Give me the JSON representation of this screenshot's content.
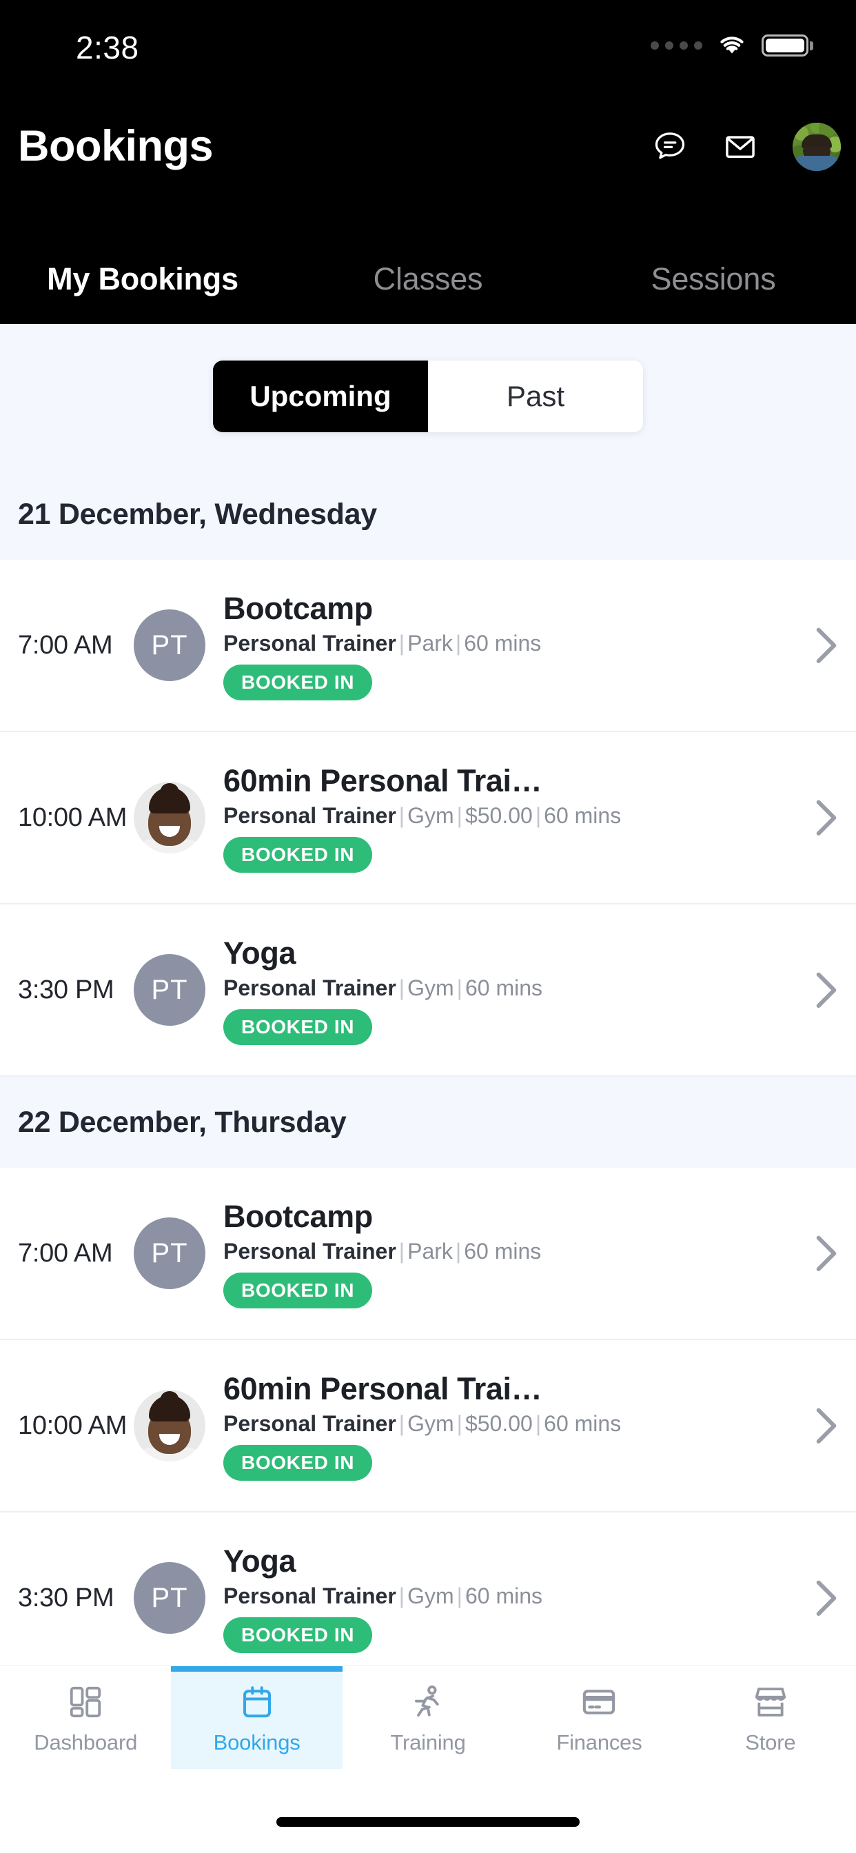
{
  "statusbar": {
    "time": "2:38",
    "signal_dots": 4,
    "wifi": "wifi-icon",
    "battery_full": true
  },
  "header": {
    "title": "Bookings",
    "icons": [
      {
        "name": "chat-icon",
        "label": "Messages"
      },
      {
        "name": "mail-icon",
        "label": "Mail"
      }
    ],
    "avatar_alt": "Profile"
  },
  "top_tabs": [
    {
      "label": "My Bookings",
      "active": true
    },
    {
      "label": "Classes",
      "active": false
    },
    {
      "label": "Sessions",
      "active": false
    }
  ],
  "segment": [
    {
      "label": "Upcoming",
      "active": true
    },
    {
      "label": "Past",
      "active": false
    }
  ],
  "days": [
    {
      "date_label": "21 December, Wednesday",
      "bookings": [
        {
          "time": "7:00 AM",
          "avatar_type": "initials",
          "avatar_initials": "PT",
          "title": "Bootcamp",
          "role": "Personal Trainer",
          "location": "Park",
          "price": "",
          "duration": "60 mins",
          "status": "BOOKED IN"
        },
        {
          "time": "10:00 AM",
          "avatar_type": "photo",
          "avatar_initials": "",
          "title": "60min Personal Trai…",
          "role": "Personal Trainer",
          "location": "Gym",
          "price": "$50.00",
          "duration": "60 mins",
          "status": "BOOKED IN"
        },
        {
          "time": "3:30 PM",
          "avatar_type": "initials",
          "avatar_initials": "PT",
          "title": "Yoga",
          "role": "Personal Trainer",
          "location": "Gym",
          "price": "",
          "duration": "60 mins",
          "status": "BOOKED IN"
        }
      ]
    },
    {
      "date_label": "22 December, Thursday",
      "bookings": [
        {
          "time": "7:00 AM",
          "avatar_type": "initials",
          "avatar_initials": "PT",
          "title": "Bootcamp",
          "role": "Personal Trainer",
          "location": "Park",
          "price": "",
          "duration": "60 mins",
          "status": "BOOKED IN"
        },
        {
          "time": "10:00 AM",
          "avatar_type": "photo",
          "avatar_initials": "",
          "title": "60min Personal Trai…",
          "role": "Personal Trainer",
          "location": "Gym",
          "price": "$50.00",
          "duration": "60 mins",
          "status": "BOOKED IN"
        },
        {
          "time": "3:30 PM",
          "avatar_type": "initials",
          "avatar_initials": "PT",
          "title": "Yoga",
          "role": "Personal Trainer",
          "location": "Gym",
          "price": "",
          "duration": "60 mins",
          "status": "BOOKED IN"
        }
      ]
    }
  ],
  "bottom_nav": [
    {
      "label": "Dashboard",
      "icon": "dashboard-grid-icon",
      "active": false
    },
    {
      "label": "Bookings",
      "icon": "calendar-icon",
      "active": true
    },
    {
      "label": "Training",
      "icon": "running-person-icon",
      "active": false
    },
    {
      "label": "Finances",
      "icon": "credit-card-icon",
      "active": false
    },
    {
      "label": "Store",
      "icon": "storefront-icon",
      "active": false
    }
  ],
  "colors": {
    "header_bg": "#000000",
    "page_bg": "#f4f7fd",
    "badge_green": "#2ebd79",
    "accent_blue": "#32a8e8",
    "active_tab_bg": "#e8f6fe",
    "avatar_gray": "#8c92a4"
  }
}
